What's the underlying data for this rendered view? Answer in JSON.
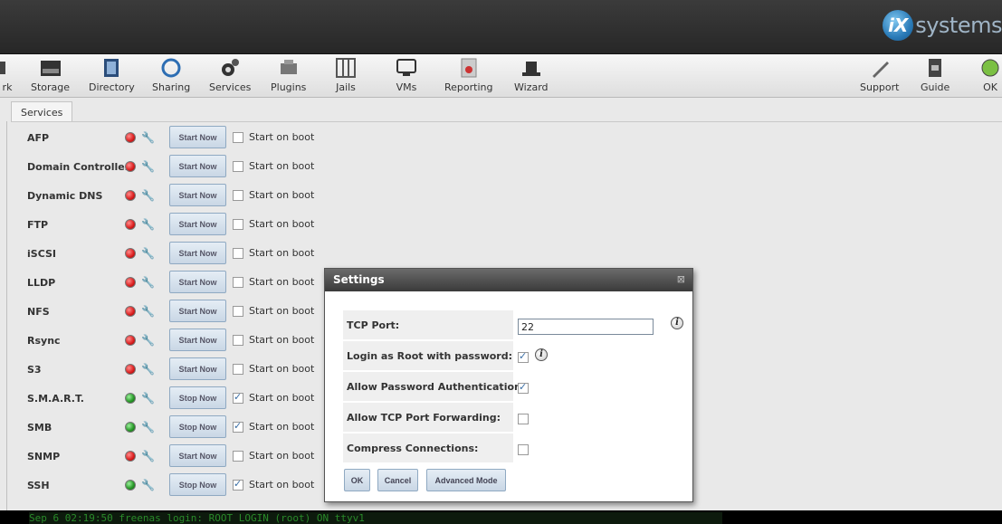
{
  "brand": {
    "logo_mark": "iX",
    "logo_word": "systems"
  },
  "toolbar": {
    "items": [
      {
        "label": "rk",
        "icon": "network-icon"
      },
      {
        "label": "Storage",
        "icon": "storage-icon"
      },
      {
        "label": "Directory",
        "icon": "directory-icon"
      },
      {
        "label": "Sharing",
        "icon": "sharing-icon"
      },
      {
        "label": "Services",
        "icon": "services-icon"
      },
      {
        "label": "Plugins",
        "icon": "plugins-icon"
      },
      {
        "label": "Jails",
        "icon": "jails-icon"
      },
      {
        "label": "VMs",
        "icon": "vms-icon"
      },
      {
        "label": "Reporting",
        "icon": "reporting-icon"
      },
      {
        "label": "Wizard",
        "icon": "wizard-icon"
      },
      {
        "label": "Support",
        "icon": "support-icon"
      },
      {
        "label": "Guide",
        "icon": "guide-icon"
      },
      {
        "label": "OK",
        "icon": "alert-ok-icon"
      }
    ]
  },
  "tabs": {
    "services": "Services"
  },
  "services": {
    "start_on_boot_label": "Start on boot",
    "rows": [
      {
        "name": "AFP",
        "running": false,
        "button": "Start Now",
        "boot": false
      },
      {
        "name": "Domain Controller",
        "running": false,
        "button": "Start Now",
        "boot": false
      },
      {
        "name": "Dynamic DNS",
        "running": false,
        "button": "Start Now",
        "boot": false
      },
      {
        "name": "FTP",
        "running": false,
        "button": "Start Now",
        "boot": false
      },
      {
        "name": "iSCSI",
        "running": false,
        "button": "Start Now",
        "boot": false
      },
      {
        "name": "LLDP",
        "running": false,
        "button": "Start Now",
        "boot": false
      },
      {
        "name": "NFS",
        "running": false,
        "button": "Start Now",
        "boot": false
      },
      {
        "name": "Rsync",
        "running": false,
        "button": "Start Now",
        "boot": false
      },
      {
        "name": "S3",
        "running": false,
        "button": "Start Now",
        "boot": false
      },
      {
        "name": "S.M.A.R.T.",
        "running": true,
        "button": "Stop Now",
        "boot": true
      },
      {
        "name": "SMB",
        "running": true,
        "button": "Stop Now",
        "boot": true
      },
      {
        "name": "SNMP",
        "running": false,
        "button": "Start Now",
        "boot": false
      },
      {
        "name": "SSH",
        "running": true,
        "button": "Stop Now",
        "boot": true
      }
    ]
  },
  "dialog": {
    "title": "Settings",
    "fields": {
      "tcp_port": {
        "label": "TCP Port:",
        "value": "22"
      },
      "login_root": {
        "label": "Login as Root with password:",
        "checked": true
      },
      "allow_password": {
        "label": "Allow Password Authentication:",
        "checked": true
      },
      "allow_forwarding": {
        "label": "Allow TCP Port Forwarding:",
        "checked": false
      },
      "compress": {
        "label": "Compress Connections:",
        "checked": false
      }
    },
    "buttons": {
      "ok": "OK",
      "cancel": "Cancel",
      "advanced": "Advanced Mode"
    }
  },
  "console": {
    "text": "Sep  6 02:19:50 freenas login: ROOT LOGIN (root) ON ttyv1"
  },
  "colors": {
    "running": "#2a9a2a",
    "stopped": "#dd2222",
    "button_border": "#8fa9c2"
  }
}
